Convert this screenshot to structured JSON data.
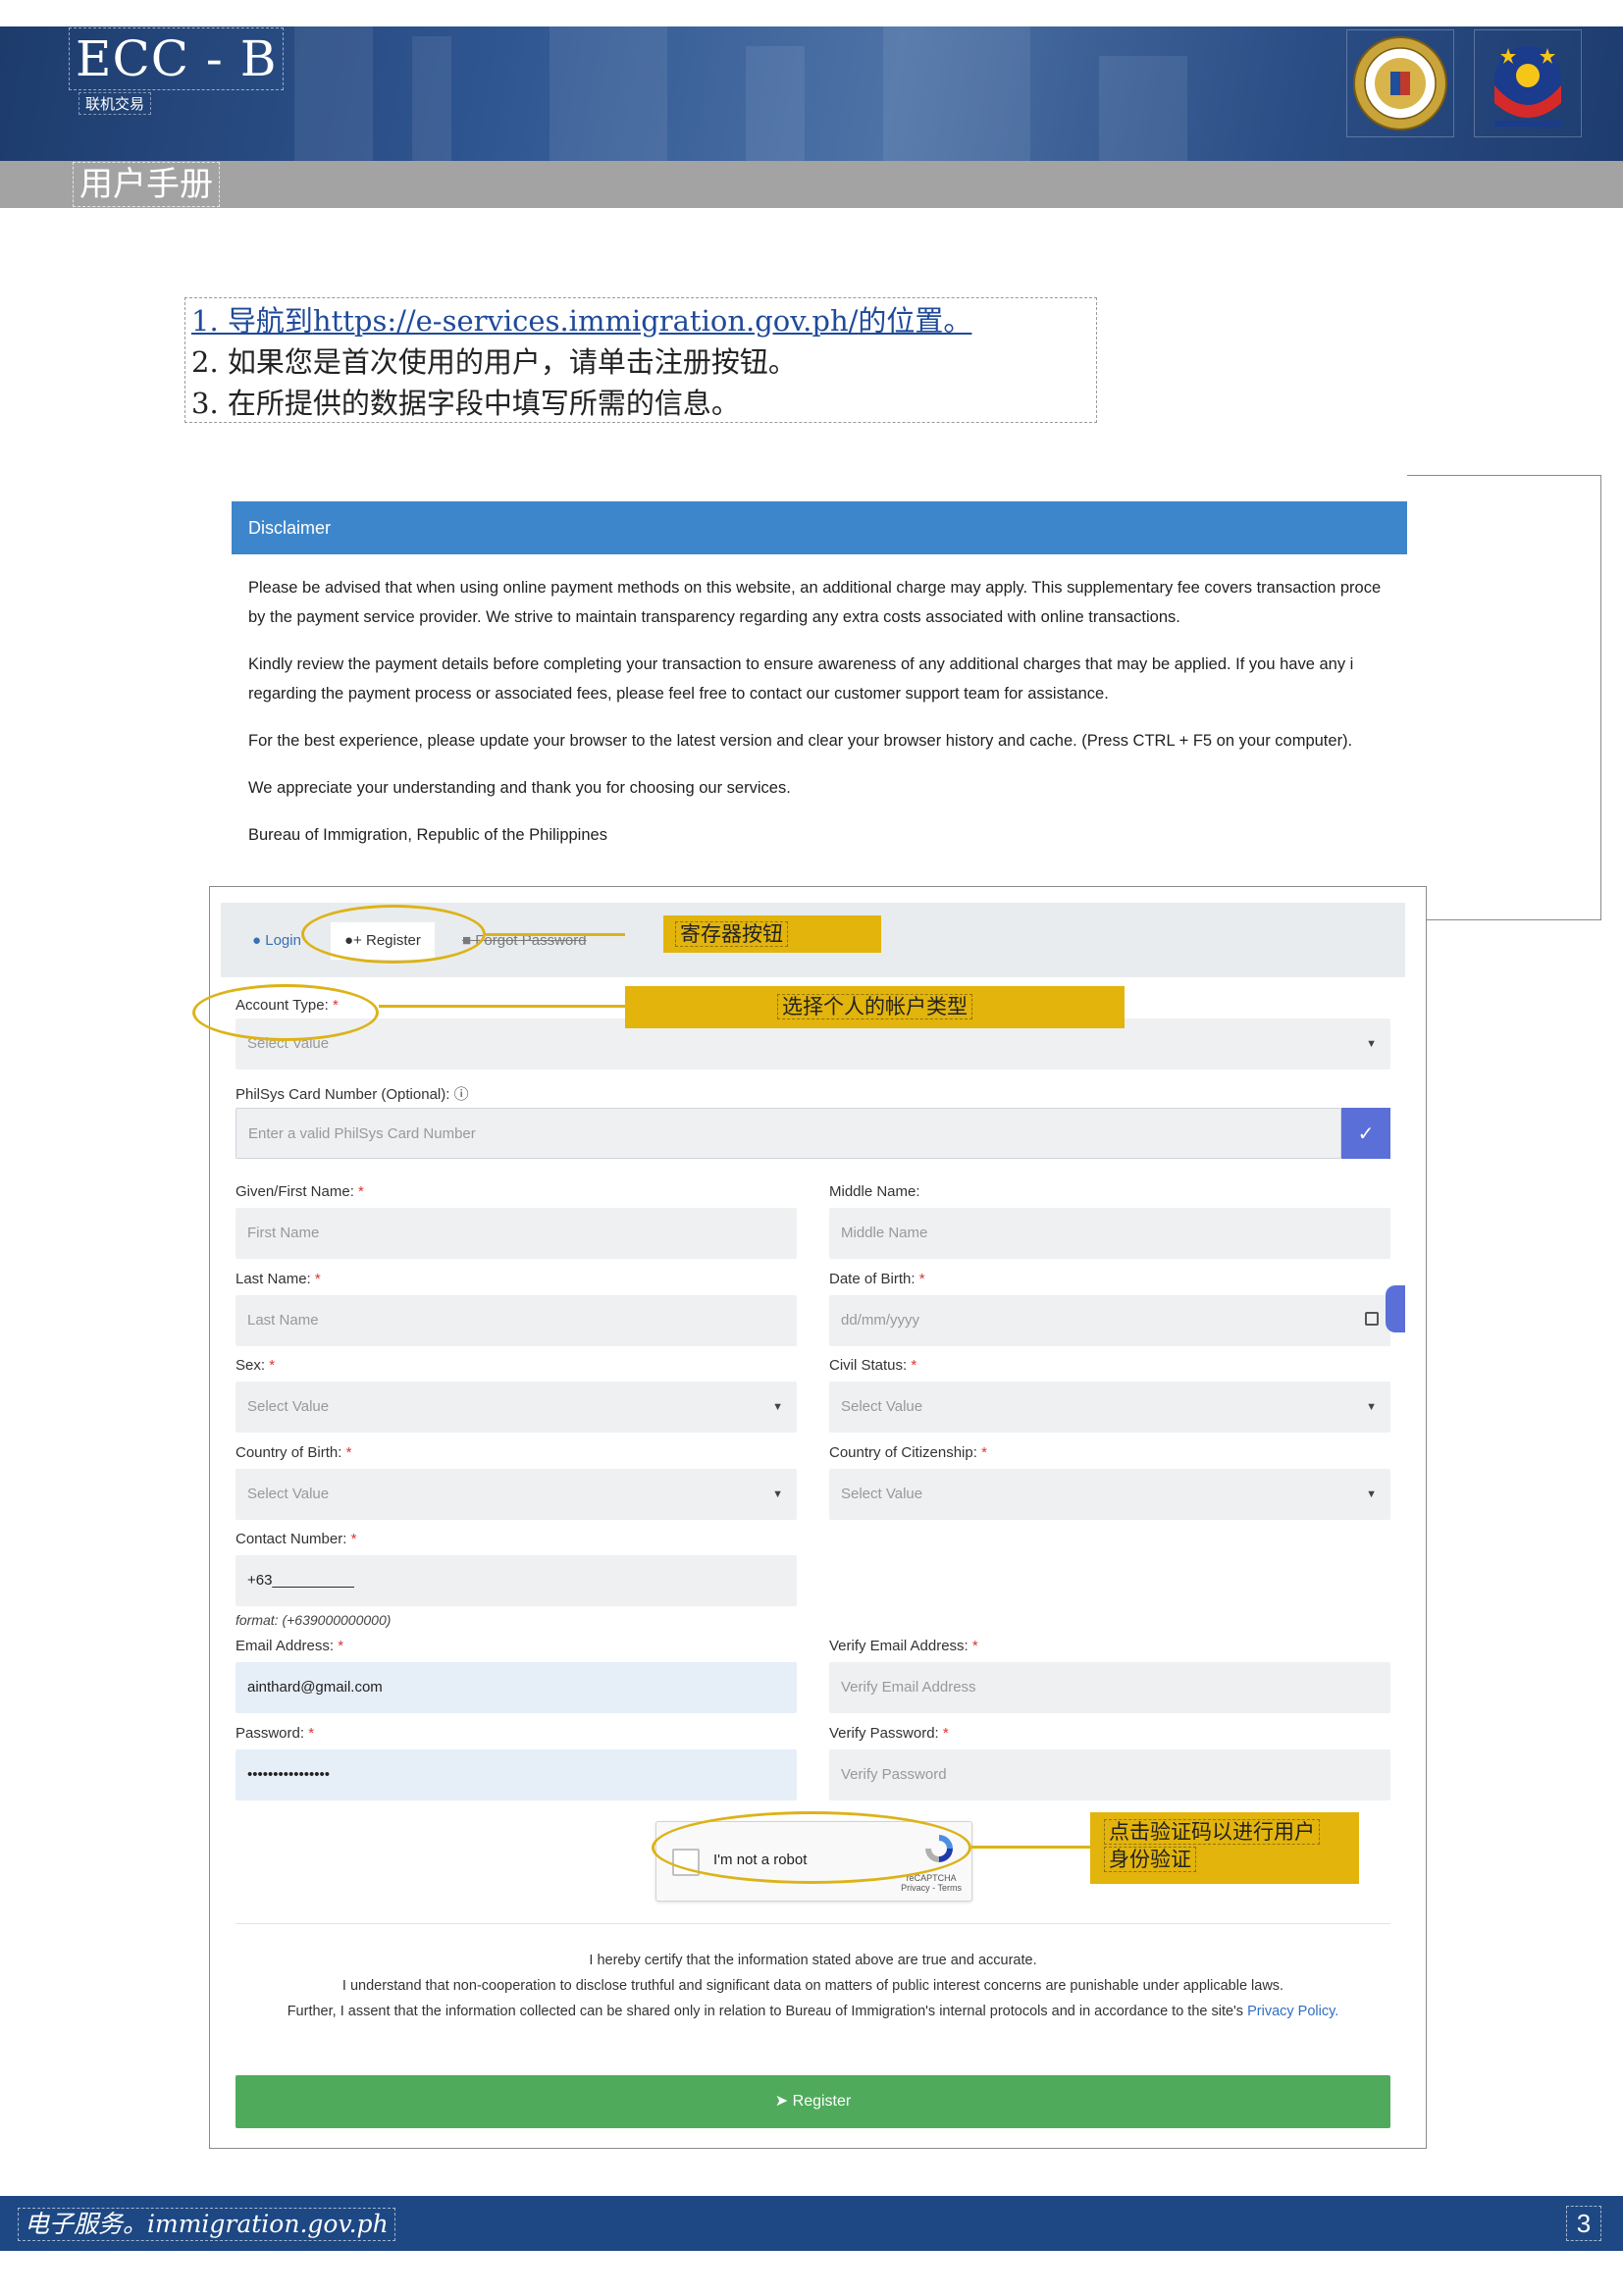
{
  "header": {
    "title": "ECC - B",
    "subtitle": "联机交易",
    "manual_title": "用户手册"
  },
  "steps": {
    "step1_prefix": "1. 导航到",
    "step1_link": "https://e-services.immigration.gov.ph/",
    "step1_suffix": "的位置。",
    "step2": "2. 如果您是首次使用的用户，请单击注册按钮。",
    "step3": "3. 在所提供的数据字段中填写所需的信息。"
  },
  "disclaimer": {
    "title": "Disclaimer",
    "p1_line1": "Please be advised that when using online payment methods on this website, an additional charge may apply. This supplementary fee covers transaction proce",
    "p1_line2": "by the payment service provider. We strive to maintain transparency regarding any extra costs associated with online transactions.",
    "p2_line1": "Kindly review the payment details before completing your transaction to ensure awareness of any additional charges that may be applied. If you have any i",
    "p2_line2": "regarding the payment process or associated fees, please feel free to contact our customer support team for assistance.",
    "p3": "For the best experience, please update your browser to the latest version and clear your browser history and cache. (Press CTRL + F5 on your computer).",
    "p4": "We appreciate your understanding and thank you for choosing our services.",
    "p5": "Bureau of Immigration, Republic of the Philippines"
  },
  "tabs": {
    "login": "Login",
    "register": "Register",
    "forgot": "Forgot Password"
  },
  "form": {
    "account_type_label": "Account Type:",
    "account_type_value": "Select Value",
    "philsys_label": "PhilSys Card Number (Optional):",
    "philsys_placeholder": "Enter a valid PhilSys Card Number",
    "first_name_label": "Given/First Name:",
    "first_name_placeholder": "First Name",
    "middle_name_label": "Middle Name:",
    "middle_name_placeholder": "Middle Name",
    "last_name_label": "Last Name:",
    "last_name_placeholder": "Last Name",
    "dob_label": "Date of Birth:",
    "dob_placeholder": "dd/mm/yyyy",
    "sex_label": "Sex:",
    "sex_value": "Select Value",
    "civil_label": "Civil Status:",
    "civil_value": "Select Value",
    "cob_label": "Country of Birth:",
    "cob_value": "Select Value",
    "coc_label": "Country of Citizenship:",
    "coc_value": "Select Value",
    "contact_label": "Contact Number:",
    "contact_value": "+63__________",
    "contact_format": "format: (+639000000000)",
    "email_label": "Email Address:",
    "email_value": "ainthard@gmail.com",
    "verify_email_label": "Verify Email Address:",
    "verify_email_placeholder": "Verify Email Address",
    "password_label": "Password:",
    "password_value": "••••••••••••••••",
    "verify_password_label": "Verify Password:",
    "verify_password_placeholder": "Verify Password",
    "required_mark": "*"
  },
  "captcha": {
    "label": "I'm not a robot",
    "brand": "reCAPTCHA",
    "links": "Privacy - Terms"
  },
  "certify": {
    "line1": "I hereby certify that the information stated above are true and accurate.",
    "line2": "I understand that non-cooperation to disclose truthful and significant data on matters of public interest concerns are punishable under applicable laws.",
    "line3": "Further, I assent that the information collected can be shared only in relation to Bureau of Immigration's internal protocols and in accordance to the site's",
    "privacy_link": "Privacy Policy."
  },
  "register_button": "Register",
  "annotations": {
    "register_button_note": "寄存器按钮",
    "account_type_note": "选择个人的帐户类型",
    "captcha_note_line1": "点击验证码以进行用户",
    "captcha_note_line2": "身份验证"
  },
  "footer": {
    "text": "电子服务。immigration.gov.ph",
    "page_number": "3"
  },
  "colors": {
    "header_blue": "#2f5591",
    "grey_band": "#a3a3a3",
    "disclaimer_blue": "#3e86cb",
    "register_green": "#4fab5b",
    "annotation_gold": "#e2b40c",
    "footer_blue": "#1d4884"
  }
}
